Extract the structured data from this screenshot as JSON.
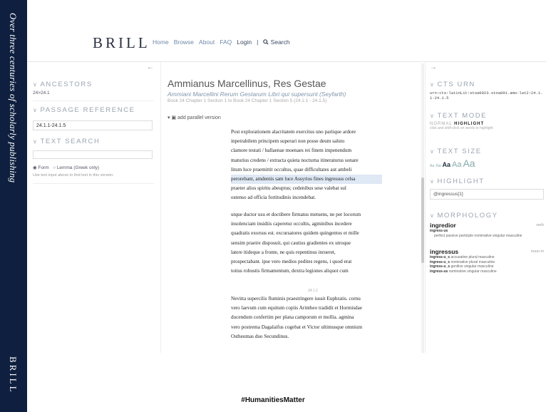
{
  "sidebar": {
    "tagline": "Over three centuries of scholarly publishing",
    "logo": "BRILL"
  },
  "header": {
    "brand": "BRILL",
    "nav": [
      "Home",
      "Browse",
      "About",
      "FAQ",
      "Login",
      "|",
      "Search"
    ]
  },
  "left_panel": {
    "collapse_icon": "arrow-left-icon",
    "ancestors_title": "ANCESTORS",
    "ancestors_value": "24>24.1",
    "passage_title": "PASSAGE REFERENCE",
    "passage_value": "24.1.1-24.1.5",
    "text_search_title": "TEXT SEARCH",
    "search_options": [
      "Form",
      "Lemma (Greek only)"
    ],
    "search_hint": "Use text input above to find text in this version."
  },
  "main": {
    "title": "Ammianus Marcellinus, Res Gestae",
    "subtitle": "Ammiani Marcellini Rerum Gestarum Libri qui supersunt (Seyfarth)",
    "citation": "Book 24 Chapter 1 Section 1 to Book 24 Chapter 1 Section 5 (24.1.1 - 24.1.5)",
    "parallel_label": "add parallel version",
    "para1": [
      "Post explorationem alacritatem exercitus uno pariique ardore",
      "inpetrabilem principem superari non posse deum saluto",
      "clamore testati / ballaenae moenaes rei finem impenendum",
      "maturius credens / extracta quieta nocturna itineraturus sonare",
      "litum luce praemittit occultus, quae difficultates aut ambeli",
      "perorebant, amdentis sam luce Assyrios fines ingressus celsa",
      "praeter alios spiritu abeuptus; cedenibus sese valebat sul",
      "ostenso ad officia fortitudinis incendebat."
    ],
    "para2": [
      "utque ductor usu et doctibere firmatus metuens, ne per locorum",
      "insolenciam insidiis caperetur occultis, agminibus incedere",
      "quadratis exorsus est. excursatores quidem quingentos et mille",
      "sensim praeire disposuit, qui cautius gradientes ex utroque",
      "latere itideque a fronte, ne quis repentinus inrueret,",
      "prospectabant. ipse vero medios pedites regens, i quod erat",
      "totius robustis firmamentum, dextra legiones aliquot cum"
    ],
    "marker": "24.1.1",
    "para3": [
      "Nevitta supercilis fluminis praestringere iussit Euphratis. cornu",
      "vero laevum cum equitum copiis Arintheo tradidit et Hormisdae",
      "ducendum confertim per plana camporum et mollia. agmina",
      "vero postrema Dagalaifus cogebat et Victor ultimusque omnium",
      "Ostheumas duo Secundinus."
    ]
  },
  "right_panel": {
    "collapse_icon": "arrow-right-icon",
    "cts_title": "CTS URN",
    "cts_value": "urn:cts:latinLit:stoa0023.stoa001.amo-lat2:24.1.1-24.1.5",
    "mode_title": "TEXT MODE",
    "mode_normal": "NORMAL",
    "mode_highlight": "HIGHLIGHT",
    "mode_hint": "click and shift-click on words to highlight",
    "size_title": "TEXT SIZE",
    "sizes": [
      "Aa",
      "Aa",
      "Aa",
      "Aa",
      "Aa"
    ],
    "highlight_title": "HIGHLIGHT",
    "highlight_value": "@ingressus[1]",
    "morph_title": "MORPHOLOGY",
    "lemma1": "ingredior",
    "lemma1_tag": "verb",
    "lemma1_form": "ingress-us",
    "lemma1_desc": "perfect passive participle nominative singular masculine",
    "lemma2": "ingressus",
    "lemma2_tag": "noun m",
    "lemma2_forms": [
      [
        "ingress-u_s",
        "accusative plural masculine"
      ],
      [
        "ingress-u_s",
        "nominative plural masculine"
      ],
      [
        "ingress-u_s",
        "genitive singular masculine"
      ],
      [
        "ingress-us",
        "nominative singular masculine"
      ]
    ]
  },
  "footer": {
    "hashtag": "#HumanitiesMatter"
  }
}
